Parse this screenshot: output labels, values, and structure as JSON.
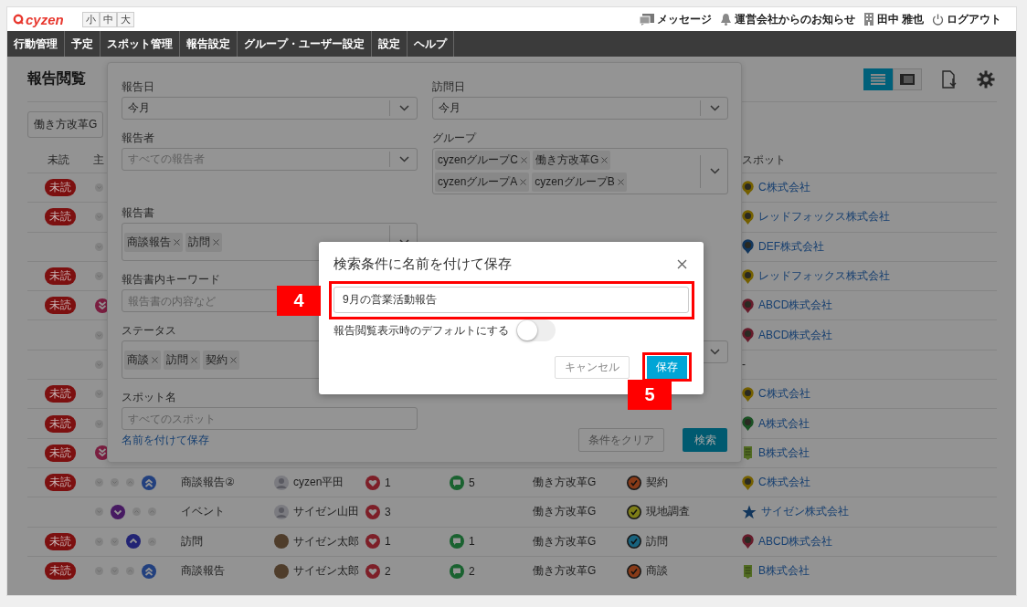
{
  "header": {
    "logo": "cyzen",
    "font_sizes": [
      {
        "label": "小",
        "selected": false
      },
      {
        "label": "中",
        "selected": false
      },
      {
        "label": "大",
        "selected": false
      }
    ],
    "links": [
      {
        "label": "メッセージ",
        "kind": "message"
      },
      {
        "label": "運営会社からのお知らせ",
        "kind": "bell"
      },
      {
        "label": "田中 雅也",
        "kind": "building"
      },
      {
        "label": "ログアウト",
        "kind": "power"
      }
    ]
  },
  "nav": [
    "行動管理",
    "予定",
    "スポット管理",
    "報告設定",
    "グループ・ユーザー設定",
    "設定",
    "ヘルプ"
  ],
  "page": {
    "title": "報告閲覧",
    "views": [
      {
        "kind": "list",
        "selected": true
      },
      {
        "kind": "card",
        "selected": false
      }
    ],
    "group_chip": "働き方改革G"
  },
  "table": {
    "columns": [
      {
        "label": "未読",
        "kind": "unread"
      },
      {
        "label": "主",
        "kind": "priority"
      },
      {
        "label": "スポット",
        "kind": "spot"
      }
    ],
    "rows": [
      {
        "badge": "未読",
        "priority": [
          {
            "kind": "lowest",
            "selected": false
          }
        ],
        "spot": {
          "name": "C株式会社",
          "kind": "pin",
          "color": "#756000"
        }
      },
      {
        "badge": "未読",
        "priority": [
          {
            "kind": "lowest",
            "selected": false
          }
        ],
        "spot": {
          "name": "レッドフォックス株式会社",
          "kind": "pin",
          "color": "#756000"
        }
      },
      {
        "priority": [
          {
            "kind": "lowest",
            "selected": false
          }
        ],
        "spot": {
          "name": "DEF株式会社",
          "kind": "pin",
          "color": "#12365c"
        }
      },
      {
        "badge": "未読",
        "priority": [
          {
            "kind": "lowest",
            "selected": false
          }
        ],
        "spot": {
          "name": "レッドフォックス株式会社",
          "kind": "pin",
          "color": "#756000"
        }
      },
      {
        "badge": "未読",
        "priority": [
          {
            "kind": "lowest",
            "selected": true
          }
        ],
        "spot": {
          "name": "ABCD株式会社",
          "kind": "pin",
          "color": "#661c2b"
        }
      },
      {
        "priority": [
          {
            "kind": "lowest",
            "selected": false
          }
        ],
        "spot": {
          "name": "ABCD株式会社",
          "kind": "pin",
          "color": "#661c2b"
        }
      },
      {
        "priority": [
          {
            "kind": "lowest",
            "selected": false
          }
        ],
        "spot": {
          "name": "-",
          "kind": "none"
        }
      },
      {
        "badge": "未読",
        "priority": [
          {
            "kind": "lowest",
            "selected": false
          }
        ],
        "spot": {
          "name": "C株式会社",
          "kind": "pin",
          "color": "#756000"
        }
      },
      {
        "badge": "未読",
        "priority": [
          {
            "kind": "lowest",
            "selected": false
          }
        ],
        "spot": {
          "name": "A株式会社",
          "kind": "pin",
          "color": "#1b5124"
        }
      },
      {
        "badge": "未読",
        "priority": [
          {
            "kind": "lowest",
            "selected": true
          }
        ],
        "spot": {
          "name": "B株式会社",
          "kind": "building",
          "color": "#516b22"
        }
      },
      {
        "badge": "未読",
        "priority": [
          {
            "kind": "lowest",
            "selected": false
          },
          {
            "kind": "low",
            "selected": false
          },
          {
            "kind": "high",
            "selected": false
          },
          {
            "kind": "highest",
            "selected": true
          }
        ],
        "title": "商談報告②",
        "user": {
          "name": "cyzen平田",
          "kind": "silhouette"
        },
        "likes": "1",
        "comments": "5",
        "group": "働き方改革G",
        "status": {
          "label": "契約",
          "color": "#873a18"
        },
        "spot": {
          "name": "C株式会社",
          "kind": "pin",
          "color": "#756000"
        }
      },
      {
        "priority": [
          {
            "kind": "lowest",
            "selected": false
          },
          {
            "kind": "low",
            "selected": true
          },
          {
            "kind": "high",
            "selected": false
          },
          {
            "kind": "highest",
            "selected": false
          }
        ],
        "title": "イベント",
        "user": {
          "name": "サイゼン山田",
          "kind": "silhouette"
        },
        "likes": "3",
        "group": "働き方改革G",
        "status": {
          "label": "現地調査",
          "color": "#7d7d18"
        },
        "spot": {
          "name": "サイゼン株式会社",
          "kind": "star",
          "color": "#12365c"
        }
      },
      {
        "badge": "未読",
        "priority": [
          {
            "kind": "lowest",
            "selected": false
          },
          {
            "kind": "low",
            "selected": false
          },
          {
            "kind": "high",
            "selected": true
          },
          {
            "kind": "highest",
            "selected": false
          }
        ],
        "title": "訪問",
        "user": {
          "name": "サイゼン太郎",
          "kind": "photo"
        },
        "likes": "1",
        "comments": "1",
        "group": "働き方改革G",
        "status": {
          "label": "訪問",
          "color": "#18627d"
        },
        "spot": {
          "name": "ABCD株式会社",
          "kind": "pin",
          "color": "#661c2b"
        }
      },
      {
        "badge": "未読",
        "priority": [
          {
            "kind": "lowest",
            "selected": false
          },
          {
            "kind": "low",
            "selected": false
          },
          {
            "kind": "high",
            "selected": false
          },
          {
            "kind": "highest",
            "selected": true
          }
        ],
        "title": "商談報告",
        "user": {
          "name": "サイゼン太郎",
          "kind": "photo"
        },
        "likes": "2",
        "comments": "2",
        "group": "働き方改革G",
        "status": {
          "label": "商談",
          "color": "#873a18"
        },
        "spot": {
          "name": "B株式会社",
          "kind": "building",
          "color": "#516b22"
        }
      }
    ]
  },
  "filter_panel": {
    "rows": [
      {
        "fields": [
          {
            "label": "報告日",
            "kind": "select",
            "value": "今月"
          },
          {
            "label": "訪問日",
            "kind": "select",
            "value": "今月"
          }
        ]
      },
      {
        "fields": [
          {
            "label": "報告者",
            "kind": "select",
            "placeholder": "すべての報告者"
          },
          {
            "label": "グループ",
            "kind": "tags",
            "tags": [
              "cyzenグループC",
              "働き方改革G",
              "cyzenグループA",
              "cyzenグループB"
            ]
          }
        ]
      },
      {
        "fields": [
          {
            "label": "報告書",
            "kind": "tags",
            "tags": [
              "商談報告",
              "訪問"
            ]
          }
        ]
      },
      {
        "fields": [
          {
            "label": "報告書内キーワード",
            "kind": "text",
            "placeholder": "報告書の内容など"
          }
        ]
      },
      {
        "fields": [
          {
            "label": "ステータス",
            "kind": "tags",
            "tags": [
              "商談",
              "訪問",
              "契約"
            ]
          },
          {
            "kind": "select"
          }
        ]
      },
      {
        "fields": [
          {
            "label": "スポット名",
            "kind": "text",
            "placeholder": "すべてのスポット"
          }
        ]
      }
    ],
    "save_link": "名前を付けて保存",
    "clear_button": "条件をクリア",
    "search_button": "検索"
  },
  "dialog": {
    "title": "検索条件に名前を付けて保存",
    "name_value": "9月の営業活動報告",
    "toggle": {
      "label": "報告閲覧表示時のデフォルトにする",
      "on": false
    },
    "cancel_button": "キャンセル",
    "save_button": "保存"
  },
  "annotations": [
    {
      "label": "4",
      "kind": "name_input"
    },
    {
      "label": "5",
      "kind": "save_button"
    }
  ]
}
